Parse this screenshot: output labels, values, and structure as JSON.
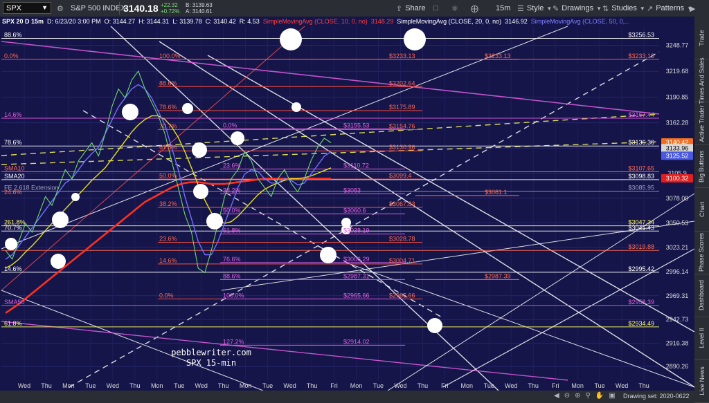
{
  "toolbar": {
    "symbol": "SPX",
    "index_name": "S&P 500 INDEX",
    "price": "3140.18",
    "change": "+22.32",
    "change_pct": "+0.72%",
    "bid": "B: 3139.63",
    "ask": "A: 3140.61",
    "share_label": "Share",
    "interval_label": "15m",
    "style_label": "Style",
    "drawings_label": "Drawings",
    "studies_label": "Studies",
    "patterns_label": "Patterns"
  },
  "infobar": {
    "header": "SPX 20 D 15m",
    "datetime": "D: 6/23/20 3:00 PM",
    "open": "O: 3144.27",
    "high": "H: 3144.31",
    "low": "L: 3139.78",
    "close": "C: 3140.42",
    "range": "R: 4.53",
    "sma10": "SimpleMovingAvg (CLOSE, 10, 0, no)",
    "sma10_val": "3148.29",
    "sma20": "SimpleMovingAvg (CLOSE, 20, 0, no)",
    "sma20_val": "3146.92",
    "sma50": "SimpleMovingAvg (CLOSE, 50, 0,..."
  },
  "sidebar": {
    "tabs": [
      "Trade",
      "Times And Sales",
      "Active Trader",
      "Big Buttons",
      "Chart",
      "Phase Scores",
      "Dashboard",
      "Level II",
      "Live News"
    ]
  },
  "bottombar": {
    "drawing_set": "Drawing set: 2020-0622"
  },
  "chart_data": {
    "type": "line",
    "ylim": [
      2875,
      3270
    ],
    "y_ticks": [
      3248.77,
      3219.68,
      3190.85,
      3162.28,
      3133.96,
      3105.9,
      3078.09,
      3050.53,
      3023.21,
      2996.14,
      2969.31,
      2942.73,
      2916.38,
      2890.26
    ],
    "x_labels": [
      "Wed",
      "Thu",
      "Mon",
      "Tue",
      "Wed",
      "Thu",
      "Mon",
      "Tue",
      "Wed",
      "Thu",
      "Mon",
      "Tue",
      "Wed",
      "Thu",
      "Fri",
      "Mon",
      "Tue",
      "Wed",
      "Thu",
      "Fri",
      "Mon",
      "Tue",
      "Wed",
      "Thu",
      "Fri",
      "Mon",
      "Tue",
      "Wed",
      "Thu"
    ],
    "axis_badges": [
      {
        "text": "3140.42",
        "value": 3140.42,
        "bg": "#f07020"
      },
      {
        "text": "3133.96",
        "value": 3133.96,
        "bg": "#d8d8d8"
      },
      {
        "text": "3125.52",
        "value": 3125.52,
        "bg": "#4a5ae0"
      },
      {
        "text": "3100.32",
        "value": 3100.32,
        "bg": "#e02020"
      }
    ],
    "price_levels": [
      {
        "label": "$3256.53",
        "value": 3256.53,
        "color": "#ffffff"
      },
      {
        "label": "$3233.13",
        "value": 3233.13,
        "color": "#ff6a50"
      },
      {
        "label": "$3167.44",
        "value": 3167.44,
        "color": "#e060e0"
      },
      {
        "label": "$3136.36",
        "value": 3136.36,
        "color": "#ffffff"
      },
      {
        "label": "$3107.65",
        "value": 3107.65,
        "color": "#ff6a50"
      },
      {
        "label": "$3098.83",
        "value": 3098.83,
        "color": "#ffffff"
      },
      {
        "label": "$3085.95",
        "value": 3085.95,
        "color": "#a0a0c0"
      },
      {
        "label": "$3047.34",
        "value": 3047.34,
        "color": "#ffff60"
      },
      {
        "label": "$3041.43",
        "value": 3041.43,
        "color": "#ffffff"
      },
      {
        "label": "$3019.88",
        "value": 3019.88,
        "color": "#ff6a50"
      },
      {
        "label": "$2995.42",
        "value": 2995.42,
        "color": "#ffffff"
      },
      {
        "label": "$2958.39",
        "value": 2958.39,
        "color": "#e060e0"
      },
      {
        "label": "$2934.49",
        "value": 2934.49,
        "color": "#ffff60"
      }
    ],
    "fib_left": [
      {
        "label": "88.6%",
        "value": 3256.53,
        "color": "#ffffff"
      },
      {
        "label": "0.0%",
        "value": 3233.13,
        "color": "#ff6a50"
      },
      {
        "label": "14.6%",
        "value": 3167.44,
        "color": "#e060e0"
      },
      {
        "label": "78.6%",
        "value": 3136.36,
        "color": "#ffffff"
      },
      {
        "label": "SMA10",
        "value": 3107.65,
        "color": "#ff6a50"
      },
      {
        "label": "SMA20",
        "value": 3098.83,
        "color": "#ffffff"
      },
      {
        "label": "FE 2.618 Extension",
        "value": 3085.95,
        "color": "#a0a0c0"
      },
      {
        "label": "24.6%",
        "value": 3081.1,
        "color": "#ff6a50"
      },
      {
        "label": "261.8%",
        "value": 3047.34,
        "color": "#ffff60"
      },
      {
        "label": "70.7%",
        "value": 3041.43,
        "color": "#ffffff"
      },
      {
        "label": "14.6%",
        "value": 2995.42,
        "color": "#ffffff"
      },
      {
        "label": "SMA50",
        "value": 2958.39,
        "color": "#e060e0"
      },
      {
        "label": "61.8%",
        "value": 2934.49,
        "color": "#ffff60"
      }
    ],
    "fib_mid": [
      {
        "label": "100.0%",
        "value": 3233.13,
        "x": 230
      },
      {
        "label": "88.6%",
        "value": 3202.64,
        "x": 230
      },
      {
        "label": "78.6%",
        "value": 3175.89,
        "x": 230
      },
      {
        "label": "70.7%",
        "value": 3154.76,
        "x": 230
      },
      {
        "label": "61.8%",
        "value": 3130.96,
        "x": 230
      },
      {
        "label": "50.0%",
        "value": 3099.4,
        "x": 230
      },
      {
        "label": "38.2%",
        "value": 3067.83,
        "x": 230
      },
      {
        "label": "23.6%",
        "value": 3028.78,
        "x": 230
      },
      {
        "label": "14.6%",
        "value": 3004.71,
        "x": 230
      },
      {
        "label": "0.0%",
        "value": 2965.66,
        "x": 230
      }
    ],
    "fib_mid_prices": [
      {
        "label": "$3233.13",
        "value": 3233.13,
        "x": 562,
        "color": "#ff6a50"
      },
      {
        "label": "$3202.64",
        "value": 3202.64,
        "x": 562,
        "color": "#ff6a50"
      },
      {
        "label": "$3175.89",
        "value": 3175.89,
        "x": 562,
        "color": "#ff6a50"
      },
      {
        "label": "$3154.76",
        "value": 3154.76,
        "x": 562,
        "color": "#ff6a50"
      },
      {
        "label": "$3130.96",
        "value": 3130.96,
        "x": 562,
        "color": "#ff6a50"
      },
      {
        "label": "$3099.4",
        "value": 3099.4,
        "x": 562,
        "color": "#ff6a50"
      },
      {
        "label": "$3067.83",
        "value": 3067.83,
        "x": 562,
        "color": "#ff6a50"
      },
      {
        "label": "$3028.78",
        "value": 3028.78,
        "x": 562,
        "color": "#ff6a50"
      },
      {
        "label": "$3004.71",
        "value": 3004.71,
        "x": 562,
        "color": "#ff6a50"
      },
      {
        "label": "$2965.66",
        "value": 2965.66,
        "x": 562,
        "color": "#ff6a50"
      }
    ],
    "fib_pink": [
      {
        "label": "0.0%",
        "value": 3155.53
      },
      {
        "label": "23.6%",
        "value": 3110.72
      },
      {
        "label": "38.2%",
        "value": 3083
      },
      {
        "label": "50.0%",
        "value": 3060.6
      },
      {
        "label": "61.8%",
        "value": 3038.19
      },
      {
        "label": "76.6%",
        "value": 3006.29
      },
      {
        "label": "88.6%",
        "value": 2987.31
      },
      {
        "label": "100.0%",
        "value": 2965.66
      },
      {
        "label": "127.2%",
        "value": 2914.02
      }
    ],
    "fib_pink_prices": [
      {
        "label": "$3155.53",
        "value": 3155.53
      },
      {
        "label": "$3110.72",
        "value": 3110.72
      },
      {
        "label": "$3083",
        "value": 3083
      },
      {
        "label": "$3060.6",
        "value": 3060.6
      },
      {
        "label": "$3038.19",
        "value": 3038.19
      },
      {
        "label": "$3006.29",
        "value": 3006.29
      },
      {
        "label": "$2987.31",
        "value": 2987.31
      },
      {
        "label": "$2965.66",
        "value": 2965.66
      },
      {
        "label": "$2914.02",
        "value": 2914.02
      }
    ],
    "extra_prices": [
      {
        "label": "$3233.13",
        "value": 3233.13,
        "x": 700,
        "color": "#ff6a50"
      },
      {
        "label": "$3081.1",
        "value": 3081.1,
        "x": 700,
        "color": "#ff6a50"
      },
      {
        "label": "$2987.39",
        "value": 2987.39,
        "x": 700,
        "color": "#ff6a50"
      }
    ],
    "watermark": [
      "pebblewriter.com",
      "SPX 15-min"
    ],
    "price_series": [
      3020,
      3010,
      3030,
      3050,
      3040,
      3060,
      3080,
      3070,
      3090,
      3110,
      3100,
      3120,
      3130,
      3140,
      3125,
      3150,
      3180,
      3200,
      3190,
      3210,
      3220,
      3200,
      3185,
      3170,
      3150,
      3120,
      3090,
      3060,
      3040,
      3000,
      2995,
      3020,
      3050,
      3080,
      3100,
      3110,
      3130,
      3120,
      3100,
      3090,
      3080,
      3100,
      3110,
      3095,
      3085,
      3100,
      3120,
      3135,
      3145,
      3140
    ],
    "sma10_series": [
      3010,
      3015,
      3025,
      3035,
      3045,
      3055,
      3065,
      3075,
      3085,
      3095,
      3100,
      3110,
      3120,
      3128,
      3135,
      3150,
      3165,
      3180,
      3190,
      3200,
      3205,
      3200,
      3190,
      3175,
      3160,
      3135,
      3110,
      3080,
      3055,
      3030,
      3015,
      3015,
      3030,
      3050,
      3070,
      3090,
      3105,
      3110,
      3108,
      3100,
      3095,
      3095,
      3100,
      3098,
      3093,
      3095,
      3105,
      3115,
      3125,
      3130
    ],
    "sma20_series": [
      3000,
      3004,
      3010,
      3018,
      3025,
      3033,
      3042,
      3050,
      3058,
      3066,
      3074,
      3082,
      3090,
      3098,
      3105,
      3112,
      3122,
      3132,
      3142,
      3152,
      3160,
      3166,
      3170,
      3170,
      3166,
      3158,
      3146,
      3130,
      3112,
      3093,
      3076,
      3062,
      3054,
      3050,
      3052,
      3058,
      3066,
      3074,
      3082,
      3088,
      3092,
      3095,
      3098,
      3100,
      3100,
      3101,
      3103,
      3106,
      3109,
      3112
    ],
    "sma50_series": [
      2950,
      2955,
      2960,
      2966,
      2972,
      2978,
      2984,
      2990,
      2996,
      3002,
      3008,
      3014,
      3020,
      3026,
      3032,
      3038,
      3044,
      3050,
      3056,
      3062,
      3068,
      3074,
      3078,
      3082,
      3086,
      3090,
      3093,
      3095,
      3096,
      3096,
      3095,
      3094,
      3094,
      3094,
      3095,
      3096,
      3097,
      3098,
      3099,
      3100,
      3100,
      3100,
      3100,
      3100,
      3100,
      3100,
      3100,
      3100,
      3100,
      3100
    ]
  }
}
